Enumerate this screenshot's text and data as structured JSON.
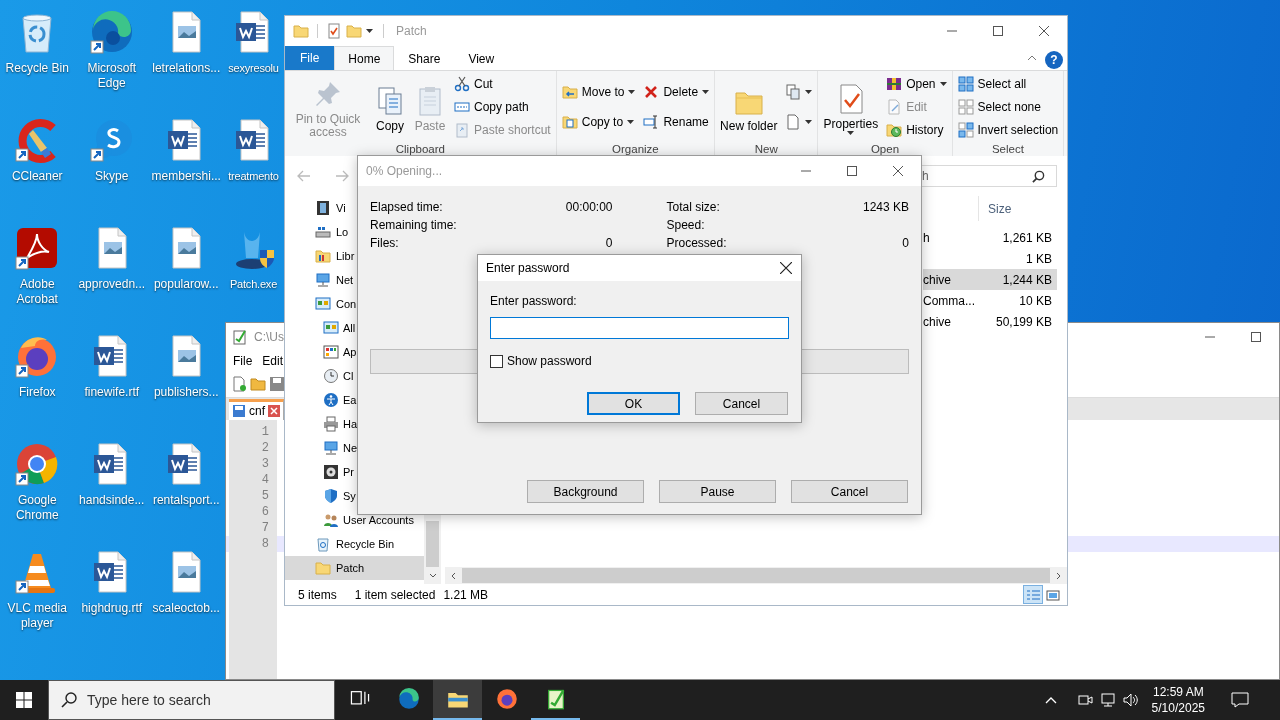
{
  "desktop": {
    "icons": [
      {
        "label": "Recycle Bin",
        "kind": "recycle",
        "shortcut": false
      },
      {
        "label": "CCleaner",
        "kind": "ccleaner",
        "shortcut": true
      },
      {
        "label": "Adobe Acrobat",
        "kind": "acrobat",
        "shortcut": true
      },
      {
        "label": "Firefox",
        "kind": "firefox",
        "shortcut": true
      },
      {
        "label": "Google Chrome",
        "kind": "chrome",
        "shortcut": true
      },
      {
        "label": "VLC media player",
        "kind": "vlc",
        "shortcut": true
      },
      {
        "label": "Microsoft Edge",
        "kind": "edge",
        "shortcut": true
      },
      {
        "label": "Skype",
        "kind": "skype",
        "shortcut": true
      },
      {
        "label": "approvedn...",
        "kind": "image",
        "shortcut": false
      },
      {
        "label": "finewife.rtf",
        "kind": "word",
        "shortcut": false
      },
      {
        "label": "handsinde...",
        "kind": "word",
        "shortcut": false
      },
      {
        "label": "highdrug.rtf",
        "kind": "word",
        "shortcut": false
      },
      {
        "label": "letrelations...",
        "kind": "image",
        "shortcut": false
      },
      {
        "label": "membershi...",
        "kind": "word",
        "shortcut": false
      },
      {
        "label": "popularow...",
        "kind": "image",
        "shortcut": false
      },
      {
        "label": "publishers...",
        "kind": "image",
        "shortcut": false
      },
      {
        "label": "rentalsport...",
        "kind": "word",
        "shortcut": false
      },
      {
        "label": "scaleoctob...",
        "kind": "image",
        "shortcut": false
      },
      {
        "label": "sexyresolu",
        "kind": "word",
        "shortcut": false
      },
      {
        "label": "treatmento",
        "kind": "word",
        "shortcut": false
      },
      {
        "label": "Patch.exe",
        "kind": "exe",
        "shortcut": false
      }
    ]
  },
  "notepad": {
    "title": "C:\\Us",
    "menu": [
      "File",
      "Edit"
    ],
    "tab": {
      "label": "cnf"
    },
    "lines": [
      {
        "number": "1",
        "current": false
      },
      {
        "number": "2",
        "current": false
      },
      {
        "number": "3",
        "current": false
      },
      {
        "number": "4",
        "current": false
      },
      {
        "number": "5",
        "current": false
      },
      {
        "number": "6",
        "current": false
      },
      {
        "number": "7",
        "current": false
      },
      {
        "number": "8",
        "current": true
      }
    ]
  },
  "explorer": {
    "title": "Patch",
    "file_button": {
      "label": "File"
    },
    "tabs": [
      {
        "label": "Home",
        "selected": true
      },
      {
        "label": "Share",
        "selected": false
      },
      {
        "label": "View",
        "selected": false
      }
    ],
    "help_glyph": "?",
    "ribbon": [
      {
        "label": "Clipboard",
        "columns": [
          {
            "items": [
              {
                "kind": "large",
                "label": "Pin to Quick access",
                "disabled": true,
                "dropdown": false
              }
            ]
          },
          {
            "items": [
              {
                "kind": "large",
                "label": "Copy",
                "disabled": false,
                "dropdown": false
              }
            ]
          },
          {
            "items": [
              {
                "kind": "large",
                "label": "Paste",
                "disabled": true,
                "dropdown": false
              }
            ]
          },
          {
            "items": [
              {
                "kind": "small",
                "label": "Cut",
                "disabled": false,
                "dropdown": false
              },
              {
                "kind": "small",
                "label": "Copy path",
                "disabled": false,
                "dropdown": false
              },
              {
                "kind": "small",
                "label": "Paste shortcut",
                "disabled": true,
                "dropdown": false
              }
            ]
          }
        ]
      },
      {
        "label": "Organize",
        "columns": [
          {
            "items": [
              {
                "kind": "small",
                "label": "Move to",
                "disabled": false,
                "dropdown": true
              },
              {
                "kind": "small",
                "label": "Copy to",
                "disabled": false,
                "dropdown": true
              }
            ]
          },
          {
            "items": [
              {
                "kind": "small",
                "label": "Delete",
                "disabled": false,
                "dropdown": true
              },
              {
                "kind": "small",
                "label": "Rename",
                "disabled": false,
                "dropdown": false
              }
            ]
          }
        ]
      },
      {
        "label": "New",
        "columns": [
          {
            "items": [
              {
                "kind": "large",
                "label": "New folder",
                "disabled": false,
                "dropdown": false
              }
            ]
          },
          {
            "items": [
              {
                "kind": "small",
                "disabled": false,
                "dropdown": true
              },
              {
                "kind": "small",
                "disabled": false,
                "dropdown": true
              }
            ]
          }
        ]
      },
      {
        "label": "Open",
        "columns": [
          {
            "items": [
              {
                "kind": "large",
                "label": "Properties",
                "disabled": false,
                "dropdown": true
              }
            ]
          },
          {
            "items": [
              {
                "kind": "small",
                "label": "Open",
                "disabled": false,
                "dropdown": true
              },
              {
                "kind": "small",
                "label": "Edit",
                "disabled": true,
                "dropdown": false
              },
              {
                "kind": "small",
                "label": "History",
                "disabled": false,
                "dropdown": false
              }
            ]
          }
        ]
      },
      {
        "label": "Select",
        "columns": [
          {
            "items": [
              {
                "kind": "small",
                "label": "Select all",
                "disabled": false,
                "dropdown": false
              },
              {
                "kind": "small",
                "label": "Select none",
                "disabled": false,
                "dropdown": false
              },
              {
                "kind": "small",
                "label": "Invert selection",
                "disabled": false,
                "dropdown": false
              }
            ]
          }
        ]
      }
    ],
    "search": {
      "placeholder": "h"
    },
    "nav": [
      {
        "label": "Vi",
        "selected": false
      },
      {
        "label": "Lo",
        "selected": false
      },
      {
        "label": "Libr",
        "selected": false
      },
      {
        "label": "Net",
        "selected": false
      },
      {
        "label": "Con",
        "selected": false,
        "children": [
          {
            "label": "All",
            "selected": false
          },
          {
            "label": "Ap",
            "selected": false
          },
          {
            "label": "Cl",
            "selected": false
          },
          {
            "label": "Ea",
            "selected": false
          },
          {
            "label": "Ha",
            "selected": false
          },
          {
            "label": "Ne",
            "selected": false
          },
          {
            "label": "Pr",
            "selected": false
          },
          {
            "label": "Sy",
            "selected": false
          },
          {
            "label": "User Accounts",
            "selected": false
          }
        ]
      },
      {
        "label": "Recycle Bin",
        "selected": false
      },
      {
        "label": "Patch",
        "selected": true
      }
    ],
    "columns": [
      {
        "label": "Size"
      }
    ],
    "rows": [
      {
        "type": "h",
        "size": "1,261 KB",
        "selected": false
      },
      {
        "size": "1 KB",
        "selected": false
      },
      {
        "type": "chive",
        "size": "1,244 KB",
        "selected": true
      },
      {
        "type": "Comma...",
        "size": "10 KB",
        "selected": false
      },
      {
        "type": "chive",
        "size": "50,199 KB",
        "selected": false
      }
    ],
    "status": {
      "count": "5 items",
      "selection": "1 item selected",
      "size": "1.21 MB"
    },
    "views": [
      {
        "selected": true
      },
      {
        "selected": false
      }
    ]
  },
  "progress_dialog": {
    "title": "0% Opening...",
    "stats_left": [
      {
        "label": "Elapsed time:",
        "value": "00:00:00"
      },
      {
        "label": "Remaining time:"
      },
      {
        "label": "Files:",
        "value": "0"
      }
    ],
    "stats_right": [
      {
        "label": "Total size:",
        "value": "1243 KB"
      },
      {
        "label": "Speed:"
      },
      {
        "label": "Processed:",
        "value": "0"
      }
    ],
    "progress": {
      "level": 0
    },
    "buttons": [
      "Background",
      "Pause",
      "Cancel"
    ]
  },
  "password_dialog": {
    "title": "Enter password",
    "label": "Enter password:",
    "show_password": {
      "label": "Show password",
      "checked": false
    },
    "buttons": [
      {
        "label": "OK",
        "default": true
      },
      {
        "label": "Cancel",
        "default": false
      }
    ]
  },
  "taskbar": {
    "search": {
      "placeholder": "Type here to search"
    },
    "apps": [
      {
        "running": false,
        "active": false
      },
      {
        "running": false,
        "active": false
      },
      {
        "running": true,
        "active": true
      },
      {
        "running": false,
        "active": false
      },
      {
        "running": true,
        "active": false
      }
    ],
    "clock": {
      "time": "12:59 AM",
      "date": "5/10/2025"
    }
  }
}
